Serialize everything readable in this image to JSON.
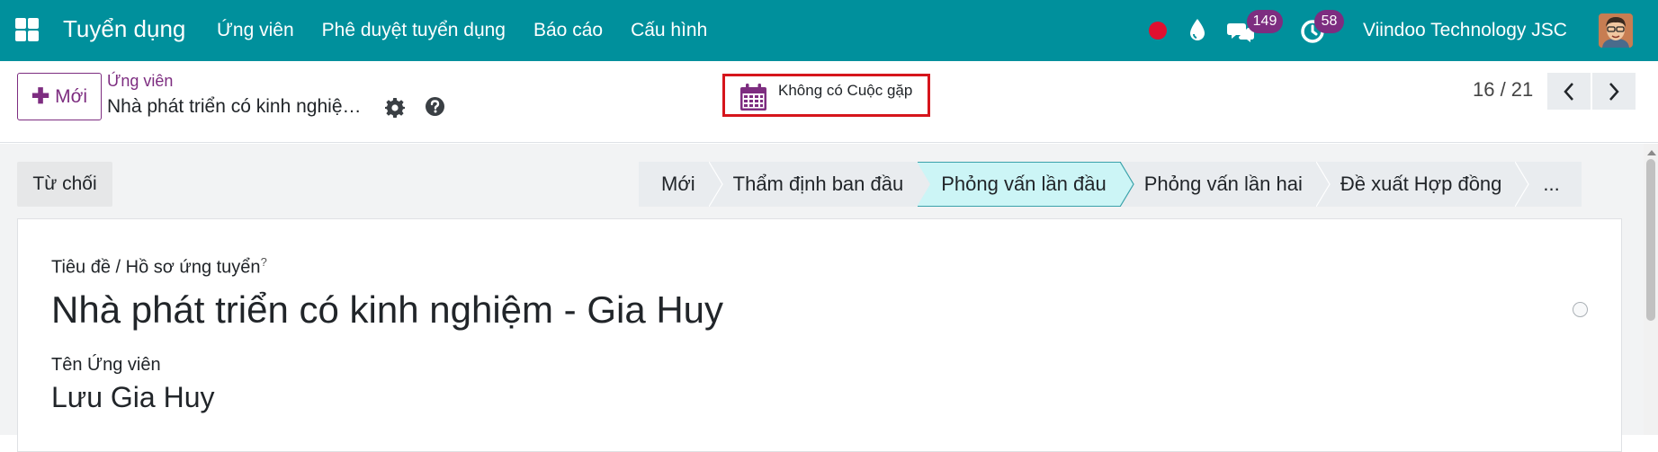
{
  "navbar": {
    "apps_icon": "apps-grid-icon",
    "brand": "Tuyển dụng",
    "menu": [
      "Ứng viên",
      "Phê duyệt tuyển dụng",
      "Báo cáo",
      "Cấu hình"
    ],
    "messages_badge": "149",
    "activities_badge": "58",
    "company": "Viindoo Technology JSC",
    "colors": {
      "bar": "#00909c",
      "badge": "#7d2d80",
      "record_dot": "#e0102f"
    }
  },
  "control_panel": {
    "new_button": "Mới",
    "breadcrumb_parent": "Ứng viên",
    "breadcrumb_current": "Nhà phát triển có kinh nghiệm - Gia Huy",
    "meeting_button": "Không có Cuộc gặp",
    "pager": "16 / 21"
  },
  "form": {
    "refuse_button": "Từ chối",
    "stages": [
      "Mới",
      "Thẩm định ban đầu",
      "Phỏng vấn lần đầu",
      "Phỏng vấn lần hai",
      "Đề xuất Hợp đồng",
      "..."
    ],
    "active_stage": "Phỏng vấn lần đầu",
    "title_label": "Tiêu đề / Hồ sơ ứng tuyển",
    "title_help": "?",
    "title_value": "Nhà phát triển có kinh nghiệm - Gia Huy",
    "partner_label": "Tên Ứng viên",
    "partner_value": "Lưu Gia Huy",
    "accent_color": "#7d2d80",
    "active_stage_color": "#ccf5f6"
  }
}
